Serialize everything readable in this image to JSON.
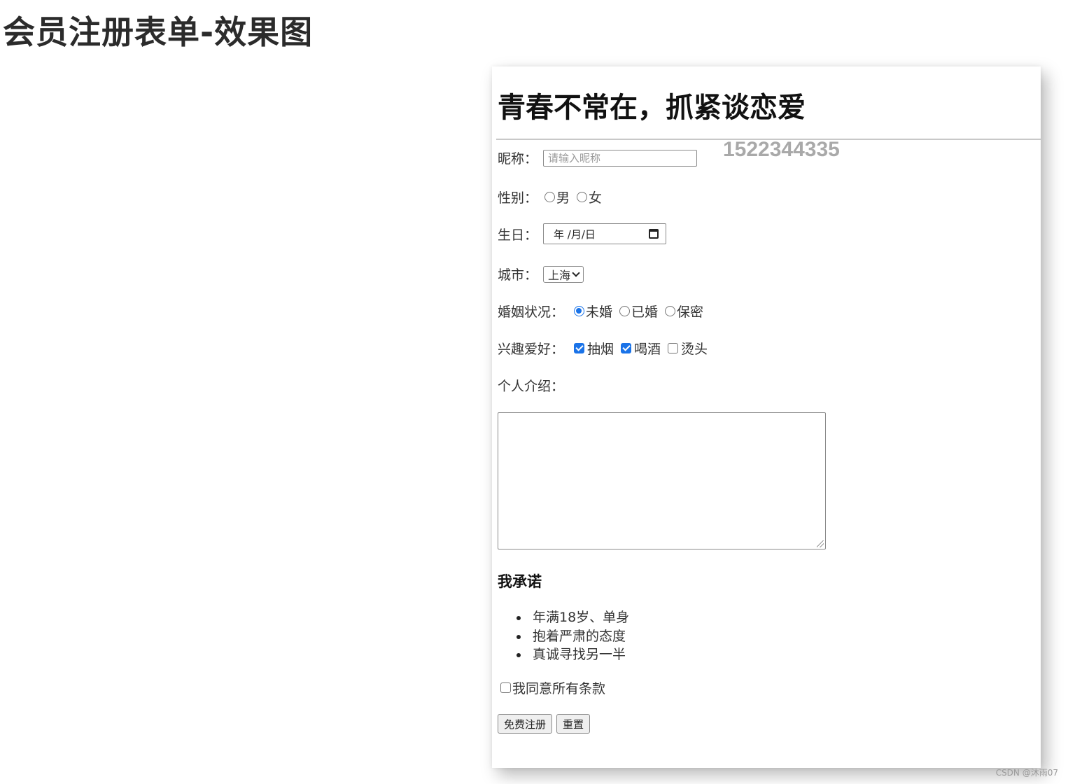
{
  "page": {
    "title": "会员注册表单-效果图"
  },
  "form": {
    "heading": "青春不常在，抓紧谈恋爱",
    "watermark_number": "1522344335",
    "nickname": {
      "label": "昵称：",
      "placeholder": "请输入昵称",
      "value": ""
    },
    "gender": {
      "label": "性别：",
      "options": [
        "男",
        "女"
      ],
      "selected": null
    },
    "birthday": {
      "label": "生日：",
      "placeholder": "年 /月/日"
    },
    "city": {
      "label": "城市：",
      "selected": "上海"
    },
    "marital": {
      "label": "婚姻状况：",
      "options": [
        "未婚",
        "已婚",
        "保密"
      ],
      "selected": "未婚"
    },
    "hobbies": {
      "label": "兴趣爱好：",
      "options": [
        {
          "label": "抽烟",
          "checked": true
        },
        {
          "label": "喝酒",
          "checked": true
        },
        {
          "label": "烫头",
          "checked": false
        }
      ]
    },
    "intro": {
      "label": "个人介绍：",
      "value": ""
    },
    "promise": {
      "heading": "我承诺",
      "items": [
        "年满18岁、单身",
        "抱着严肃的态度",
        "真诚寻找另一半"
      ]
    },
    "agree": {
      "label": "我同意所有条款",
      "checked": false
    },
    "buttons": {
      "submit": "免费注册",
      "reset": "重置"
    }
  },
  "credit": "CSDN @沐雨07",
  "colors": {
    "accent": "#1a73e8",
    "watermark": "#a9a9a9"
  },
  "icons": {
    "calendar": "calendar-icon",
    "dropdown": "chevron-down-icon"
  }
}
